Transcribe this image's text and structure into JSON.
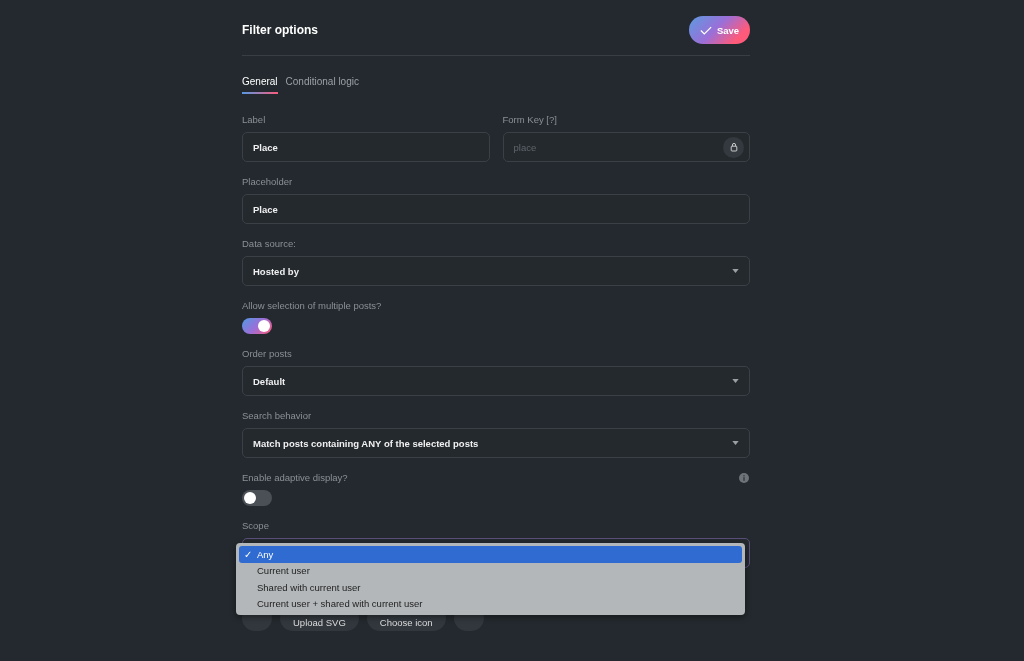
{
  "title": "Filter options",
  "save_button": {
    "label": "Save"
  },
  "tabs": [
    {
      "label": "General",
      "selected": true
    },
    {
      "label": "Conditional logic",
      "selected": false
    }
  ],
  "key_row": [
    {
      "label": "Label",
      "value": "Place",
      "locked": false
    },
    {
      "label": "Form Key [?]",
      "placeholder": "place",
      "locked": true
    }
  ],
  "fields": [
    {
      "kind": "text",
      "label": "Placeholder",
      "value": "Place"
    },
    {
      "kind": "select",
      "label": "Data source:",
      "value": "Hosted by"
    },
    {
      "kind": "toggle",
      "label": "Allow selection of multiple posts?",
      "on": true
    },
    {
      "kind": "select",
      "label": "Order posts",
      "value": "Default"
    },
    {
      "kind": "select",
      "label": "Search behavior",
      "value": "Match posts containing ANY of the selected posts"
    },
    {
      "kind": "toggle",
      "label": "Enable adaptive display?",
      "on": false,
      "info": true
    },
    {
      "kind": "dropdown",
      "label": "Scope",
      "check_mark": "✓",
      "options": [
        {
          "label": "Any",
          "selected": true
        },
        {
          "label": "Current user",
          "selected": false
        },
        {
          "label": "Shared with current user",
          "selected": false
        },
        {
          "label": "Current user + shared with current user",
          "selected": false
        }
      ]
    }
  ],
  "icon_buttons": [
    "Upload SVG",
    "Choose icon"
  ]
}
